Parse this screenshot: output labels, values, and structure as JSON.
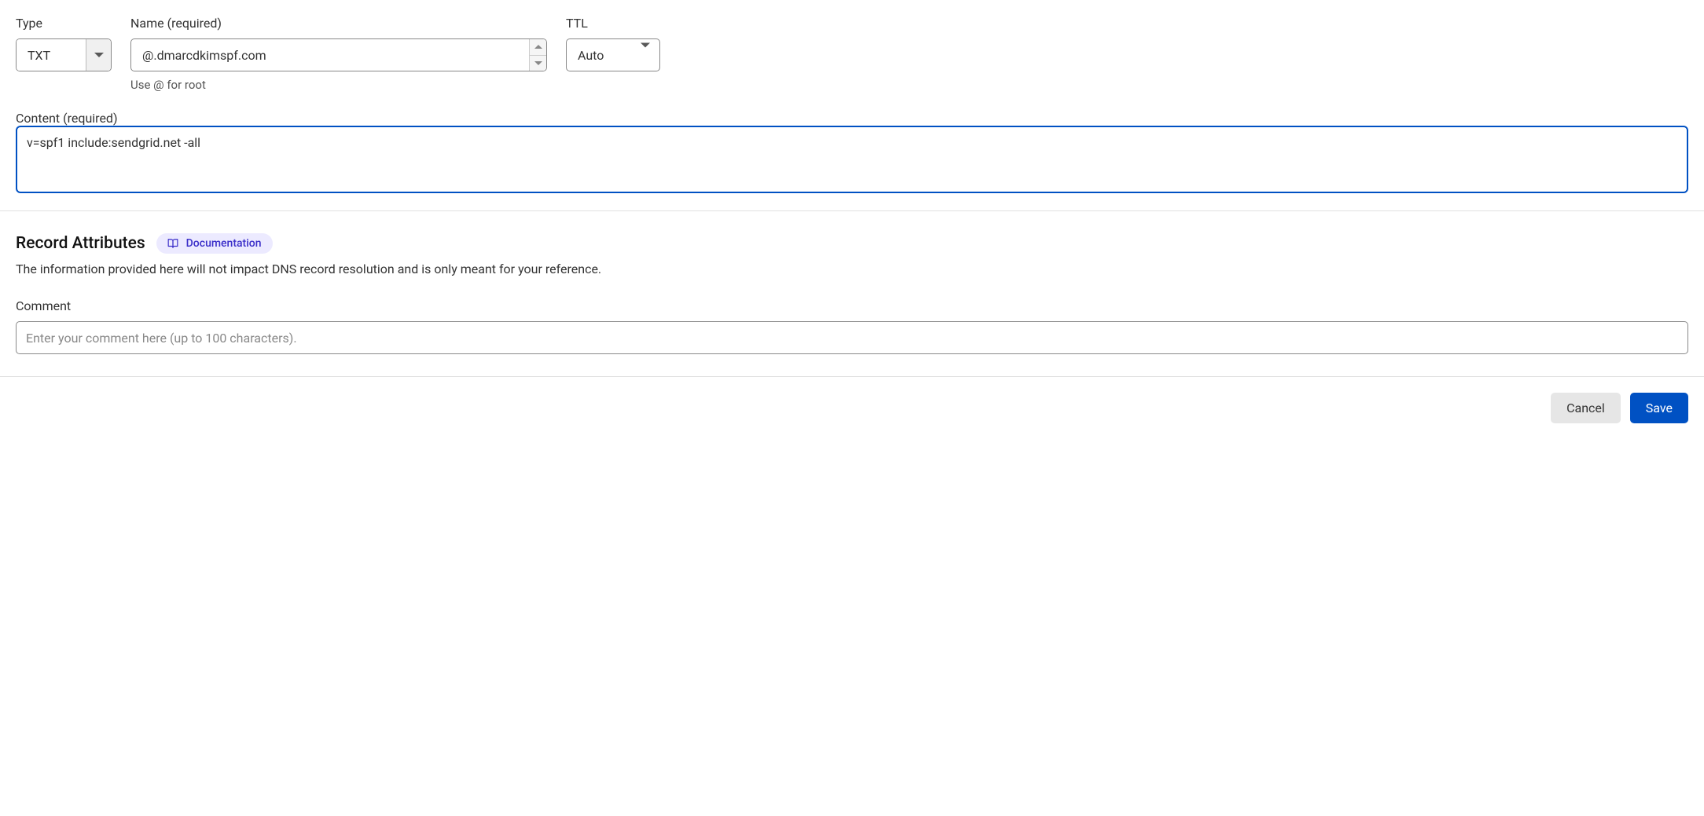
{
  "fields": {
    "type": {
      "label": "Type",
      "value": "TXT"
    },
    "name": {
      "label": "Name (required)",
      "value": "@.dmarcdkimspf.com",
      "hint": "Use @ for root"
    },
    "ttl": {
      "label": "TTL",
      "value": "Auto"
    },
    "content": {
      "label": "Content (required)",
      "value": "v=spf1 include:sendgrid.net -all"
    },
    "comment": {
      "label": "Comment",
      "placeholder": "Enter your comment here (up to 100 characters)."
    }
  },
  "attributes_section": {
    "title": "Record Attributes",
    "doc_label": "Documentation",
    "description": "The information provided here will not impact DNS record resolution and is only meant for your reference."
  },
  "buttons": {
    "cancel": "Cancel",
    "save": "Save"
  }
}
